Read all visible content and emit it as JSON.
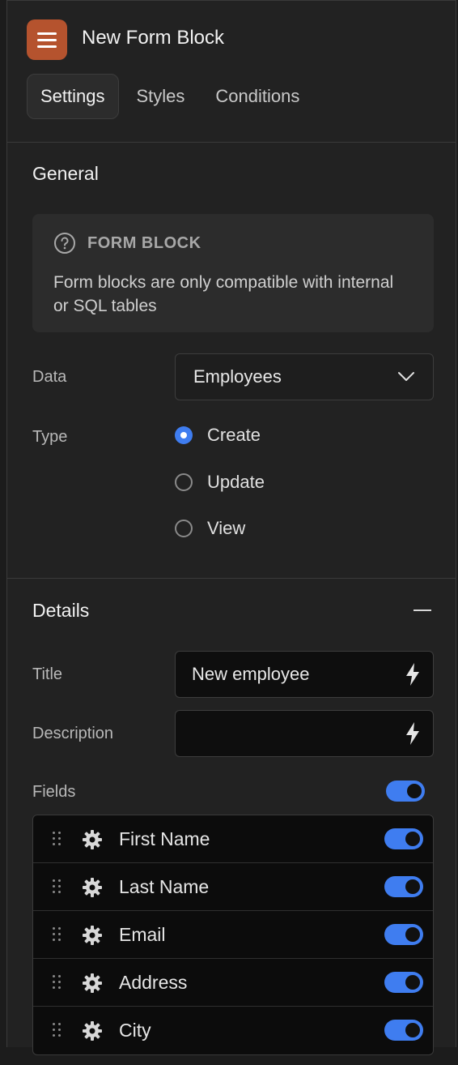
{
  "header": {
    "title": "New Form Block",
    "tabs": [
      {
        "label": "Settings",
        "active": true
      },
      {
        "label": "Styles",
        "active": false
      },
      {
        "label": "Conditions",
        "active": false
      }
    ]
  },
  "general": {
    "title": "General",
    "info": {
      "heading": "FORM BLOCK",
      "text": "Form blocks are only compatible with internal or SQL tables"
    },
    "data_label": "Data",
    "data_value": "Employees",
    "type_label": "Type",
    "type_options": [
      {
        "label": "Create",
        "selected": true
      },
      {
        "label": "Update",
        "selected": false
      },
      {
        "label": "View",
        "selected": false
      }
    ]
  },
  "details": {
    "title": "Details",
    "title_label": "Title",
    "title_value": "New employee",
    "description_label": "Description",
    "description_value": "",
    "fields_label": "Fields",
    "fields_enabled": true,
    "fields": [
      {
        "name": "First Name",
        "enabled": true
      },
      {
        "name": "Last Name",
        "enabled": true
      },
      {
        "name": "Email",
        "enabled": true
      },
      {
        "name": "Address",
        "enabled": true
      },
      {
        "name": "City",
        "enabled": true
      }
    ]
  },
  "colors": {
    "accent": "#3f7df0",
    "brand": "#b5532e",
    "background": "#222222"
  }
}
